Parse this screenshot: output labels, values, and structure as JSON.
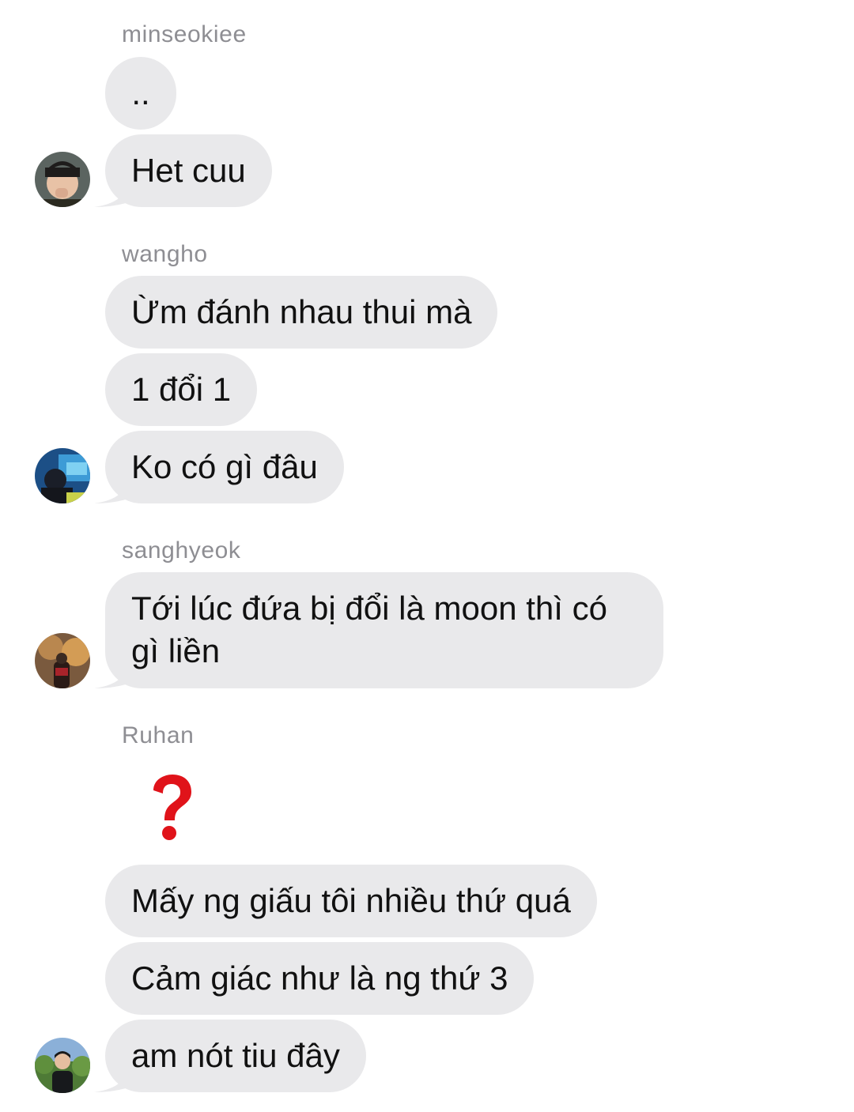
{
  "messages": [
    {
      "sender": "minseokiee",
      "bubbles": [
        "..",
        "Het cuu"
      ]
    },
    {
      "sender": "wangho",
      "bubbles": [
        "Ừm đánh nhau thui mà",
        "1 đổi 1",
        "Ko có gì đâu"
      ]
    },
    {
      "sender": "sanghyeok",
      "bubbles": [
        "Tới lúc đứa bị đổi là moon thì có gì liền"
      ]
    },
    {
      "sender": "Ruhan",
      "reaction": "question-mark",
      "bubbles": [
        "Mấy ng giấu tôi nhiều thứ quá",
        "Cảm giác như là ng thứ 3",
        "am nót tiu đây"
      ]
    }
  ],
  "colors": {
    "bubble_bg": "#e9e9eb",
    "sender_name": "#8e8e93",
    "text": "#111111",
    "reaction_red": "#e0131a"
  }
}
